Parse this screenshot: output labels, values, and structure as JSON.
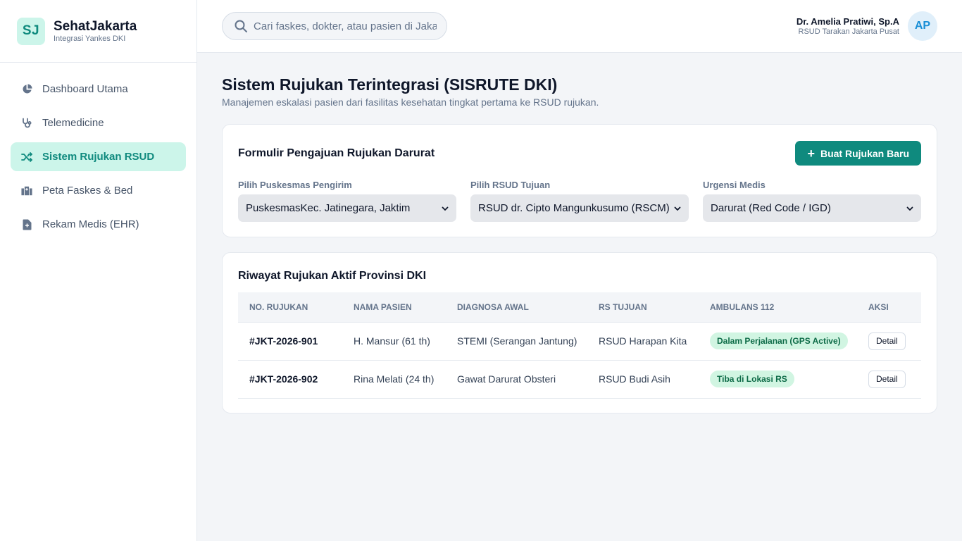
{
  "brand": {
    "logo": "SJ",
    "name": "SehatJakarta",
    "subtitle": "Integrasi Yankes DKI"
  },
  "sidebar": {
    "items": [
      {
        "label": "Dashboard Utama",
        "icon": "pie-chart-icon",
        "active": false
      },
      {
        "label": "Telemedicine",
        "icon": "stethoscope-icon",
        "active": false
      },
      {
        "label": "Sistem Rujukan RSUD",
        "icon": "shuffle-icon",
        "active": true
      },
      {
        "label": "Peta Faskes & Bed",
        "icon": "hospital-building-icon",
        "active": false
      },
      {
        "label": "Rekam Medis (EHR)",
        "icon": "medical-file-icon",
        "active": false
      }
    ]
  },
  "header": {
    "search_placeholder": "Cari faskes, dokter, atau pasien di Jakarta",
    "user_name": "Dr. Amelia Pratiwi, Sp.A",
    "user_role": "RSUD Tarakan Jakarta Pusat",
    "avatar_initials": "AP"
  },
  "page": {
    "title": "Sistem Rujukan Terintegrasi (SISRUTE DKI)",
    "subtitle": "Manajemen eskalasi pasien dari fasilitas kesehatan tingkat pertama ke RSUD rujukan."
  },
  "form": {
    "title": "Formulir Pengajuan Rujukan Darurat",
    "new_button": "Buat Rujukan Baru",
    "fields": [
      {
        "label": "Pilih Puskesmas Pengirim",
        "value": "PuskesmasKec. Jatinegara, Jaktim"
      },
      {
        "label": "Pilih RSUD Tujuan",
        "value": "RSUD dr. Cipto Mangunkusumo (RSCM)"
      },
      {
        "label": "Urgensi Medis",
        "value": "Darurat (Red Code / IGD)"
      }
    ]
  },
  "history": {
    "title": "Riwayat Rujukan Aktif Provinsi DKI",
    "columns": [
      "NO. RUJUKAN",
      "NAMA PASIEN",
      "DIAGNOSA AWAL",
      "RS TUJUAN",
      "AMBULANS 112",
      "AKSI"
    ],
    "rows": [
      {
        "code": "#JKT-2026-901",
        "patient": "H. Mansur (61 th)",
        "diagnosis": "STEMI (Serangan Jantung)",
        "hospital": "RSUD Harapan Kita",
        "status": "Dalam Perjalanan (GPS Active)",
        "action": "Detail"
      },
      {
        "code": "#JKT-2026-902",
        "patient": "Rina Melati (24 th)",
        "diagnosis": "Gawat Darurat Obsteri",
        "hospital": "RSUD Budi Asih",
        "status": "Tiba di Lokasi RS",
        "action": "Detail"
      }
    ]
  },
  "colors": {
    "accent": "#0f8a7e",
    "accent_soft": "#ccf5ea",
    "badge_bg": "#d1f5e2",
    "badge_text": "#0d6b47"
  }
}
